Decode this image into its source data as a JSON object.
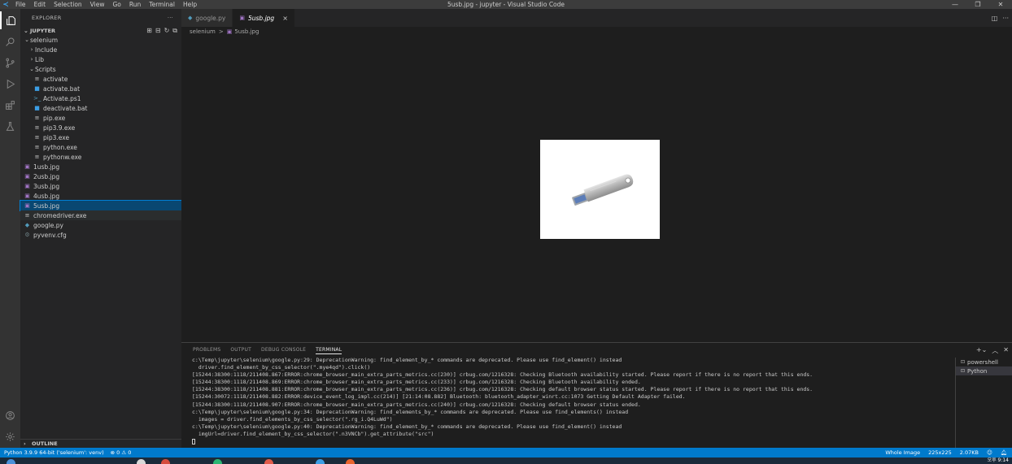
{
  "window": {
    "title": "5usb.jpg - jupyter - Visual Studio Code",
    "menu": [
      "File",
      "Edit",
      "Selection",
      "View",
      "Go",
      "Run",
      "Terminal",
      "Help"
    ]
  },
  "sidebar": {
    "header": "EXPLORER",
    "more": "···",
    "section": "JUPYTER",
    "tree": [
      {
        "label": "selenium",
        "kind": "folder",
        "open": true,
        "depth": 1
      },
      {
        "label": "Include",
        "kind": "folder",
        "open": false,
        "depth": 2
      },
      {
        "label": "Lib",
        "kind": "folder",
        "open": false,
        "depth": 2
      },
      {
        "label": "Scripts",
        "kind": "folder",
        "open": true,
        "depth": 2
      },
      {
        "label": "activate",
        "kind": "file",
        "icon": "≡",
        "depth": 3
      },
      {
        "label": "activate.bat",
        "kind": "file",
        "icon": "■",
        "depth": 3
      },
      {
        "label": "Activate.ps1",
        "kind": "file",
        "icon": ">_",
        "depth": 3
      },
      {
        "label": "deactivate.bat",
        "kind": "file",
        "icon": "■",
        "depth": 3
      },
      {
        "label": "pip.exe",
        "kind": "file",
        "icon": "≡",
        "depth": 3
      },
      {
        "label": "pip3.9.exe",
        "kind": "file",
        "icon": "≡",
        "depth": 3
      },
      {
        "label": "pip3.exe",
        "kind": "file",
        "icon": "≡",
        "depth": 3
      },
      {
        "label": "python.exe",
        "kind": "file",
        "icon": "≡",
        "depth": 3
      },
      {
        "label": "pythonw.exe",
        "kind": "file",
        "icon": "≡",
        "depth": 3
      },
      {
        "label": "1usb.jpg",
        "kind": "file",
        "icon": "▣",
        "depth": 1
      },
      {
        "label": "2usb.jpg",
        "kind": "file",
        "icon": "▣",
        "depth": 1
      },
      {
        "label": "3usb.jpg",
        "kind": "file",
        "icon": "▣",
        "depth": 1
      },
      {
        "label": "4usb.jpg",
        "kind": "file",
        "icon": "▣",
        "depth": 1
      },
      {
        "label": "5usb.jpg",
        "kind": "file",
        "icon": "▣",
        "depth": 1,
        "selected": true
      },
      {
        "label": "chromedriver.exe",
        "kind": "file",
        "icon": "≡",
        "depth": 1,
        "hovered": true
      },
      {
        "label": "google.py",
        "kind": "file",
        "icon": "◆",
        "depth": 1
      },
      {
        "label": "pyvenv.cfg",
        "kind": "file",
        "icon": "⚙",
        "depth": 1
      }
    ],
    "outline": "OUTLINE"
  },
  "editor": {
    "tabs": [
      {
        "label": "google.py",
        "icon": "◆",
        "active": false
      },
      {
        "label": "5usb.jpg",
        "icon": "▣",
        "active": true,
        "close": "×"
      }
    ],
    "breadcrumb": [
      "selenium",
      "5usb.jpg"
    ],
    "breadcrumb_sep": ">"
  },
  "panel": {
    "tabs": [
      "PROBLEMS",
      "OUTPUT",
      "DEBUG CONSOLE",
      "TERMINAL"
    ],
    "active_tab": "TERMINAL",
    "terminal_lines": [
      "c:\\Temp\\jupyter\\selenium\\google.py:29: DeprecationWarning: find_element_by_* commands are deprecated. Please use find_element() instead",
      "  driver.find_element_by_css_selector(\".mye4qd\").click()",
      "[15244:38300:1118/211408.867:ERROR:chrome_browser_main_extra_parts_metrics.cc(230)] crbug.com/1216328: Checking Bluetooth availability started. Please report if there is no report that this ends.",
      "[15244:38300:1118/211408.869:ERROR:chrome_browser_main_extra_parts_metrics.cc(233)] crbug.com/1216328: Checking Bluetooth availability ended.",
      "[15244:38300:1118/211408.881:ERROR:chrome_browser_main_extra_parts_metrics.cc(236)] crbug.com/1216328: Checking default browser status started. Please report if there is no report that this ends.",
      "[15244:30072:1118/211408.882:ERROR:device_event_log_impl.cc(214)] [21:14:08.882] Bluetooth: bluetooth_adapter_winrt.cc:1073 Getting Default Adapter failed.",
      "[15244:38300:1118/211408.907:ERROR:chrome_browser_main_extra_parts_metrics.cc(240)] crbug.com/1216328: Checking default browser status ended.",
      "c:\\Temp\\jupyter\\selenium\\google.py:34: DeprecationWarning: find_elements_by_* commands are deprecated. Please use find_elements() instead",
      "  images = driver.find_elements_by_css_selector(\".rg_i.Q4LuWd\")",
      "c:\\Temp\\jupyter\\selenium\\google.py:40: DeprecationWarning: find_element_by_* commands are deprecated. Please use find_element() instead",
      "  imgUrl=driver.find_element_by_css_selector(\".n3VNCb\").get_attribute(\"src\")"
    ],
    "terminals": [
      {
        "label": "powershell",
        "active": false
      },
      {
        "label": "Python",
        "active": true
      }
    ]
  },
  "statusbar": {
    "interpreter": "Python 3.9.9 64-bit ('selenium': venv)",
    "problems": "⊗ 0 ⚠ 0",
    "whole_image": "Whole Image",
    "dimensions": "225x225",
    "size": "2.07KB"
  },
  "taskbar": {
    "clock": "오후 9:14"
  },
  "colors": {
    "accent": "#007acc",
    "selection": "#094771",
    "sidebar_bg": "#252526",
    "editor_bg": "#1e1e1e"
  }
}
